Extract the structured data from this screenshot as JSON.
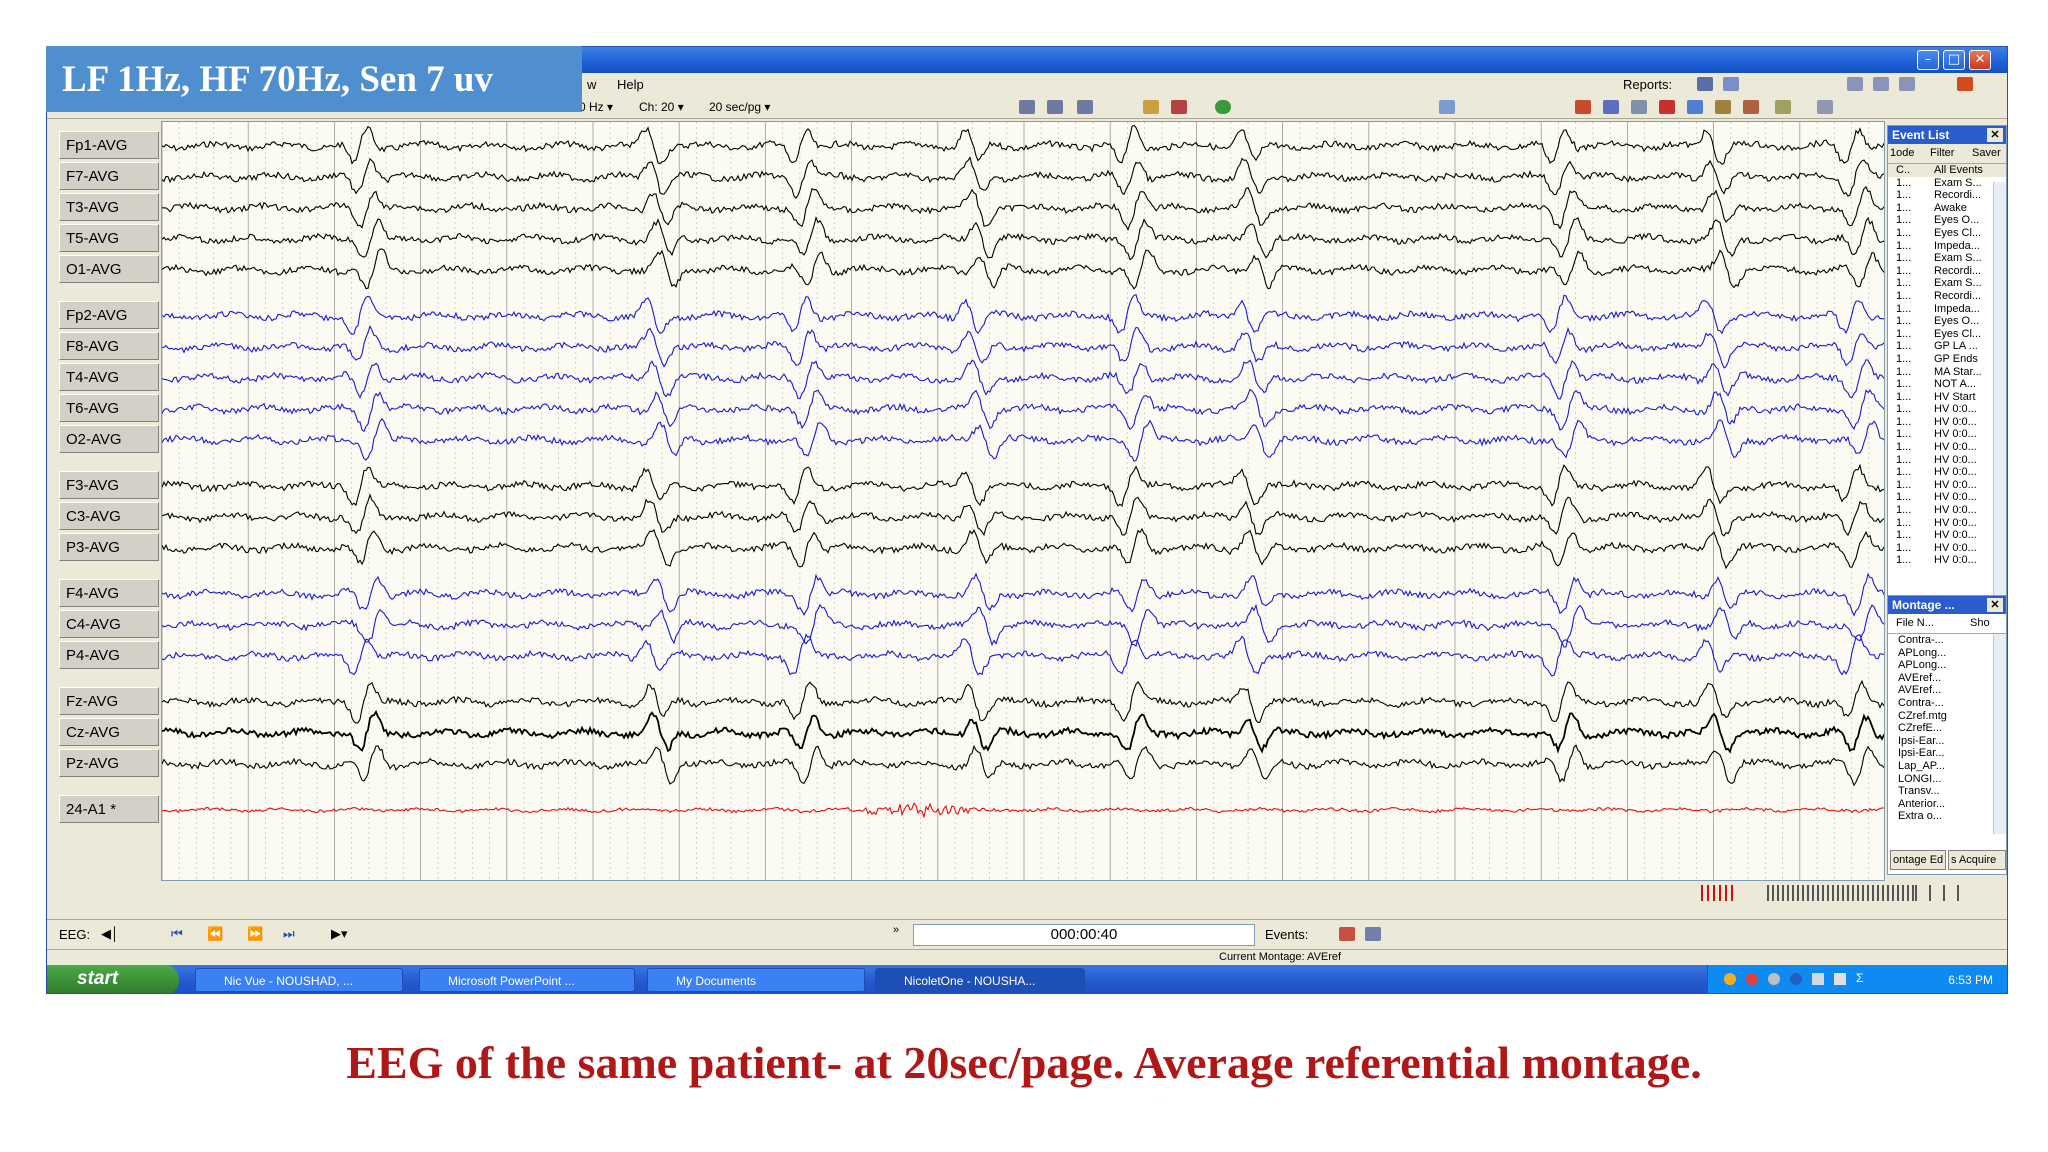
{
  "overlay": {
    "settings": "LF 1Hz, HF 70Hz, Sen 7 uv"
  },
  "window": {
    "menu": [
      "w",
      "Help"
    ],
    "reports_label": "Reports:",
    "toolbar": {
      "filter_fragment": "0 Hz",
      "channels": "Ch: 20",
      "speed": "20 sec/pg"
    }
  },
  "channels": [
    {
      "label": "Fp1-AVG",
      "color": "#000000"
    },
    {
      "label": "F7-AVG",
      "color": "#000000"
    },
    {
      "label": "T3-AVG",
      "color": "#000000"
    },
    {
      "label": "T5-AVG",
      "color": "#000000"
    },
    {
      "label": "O1-AVG",
      "color": "#000000"
    },
    {
      "label": "Fp2-AVG",
      "color": "#1a1ad0"
    },
    {
      "label": "F8-AVG",
      "color": "#1a1ad0"
    },
    {
      "label": "T4-AVG",
      "color": "#1a1ad0"
    },
    {
      "label": "T6-AVG",
      "color": "#1a1ad0"
    },
    {
      "label": "O2-AVG",
      "color": "#1a1ad0"
    },
    {
      "label": "F3-AVG",
      "color": "#000000"
    },
    {
      "label": "C3-AVG",
      "color": "#000000"
    },
    {
      "label": "P3-AVG",
      "color": "#000000"
    },
    {
      "label": "F4-AVG",
      "color": "#1a1ad0"
    },
    {
      "label": "C4-AVG",
      "color": "#1a1ad0"
    },
    {
      "label": "P4-AVG",
      "color": "#1a1ad0"
    },
    {
      "label": "Fz-AVG",
      "color": "#000000"
    },
    {
      "label": "Cz-AVG",
      "color": "#000000"
    },
    {
      "label": "Pz-AVG",
      "color": "#000000"
    },
    {
      "label": "24-A1 *",
      "color": "#e01010"
    }
  ],
  "event_list": {
    "title": "Event List",
    "tabs": [
      "1ode",
      "Filter",
      "Saver"
    ],
    "columns": [
      "C..",
      "All Events"
    ],
    "items": [
      {
        "c": "1...",
        "name": "Exam S..."
      },
      {
        "c": "1...",
        "name": "Recordi..."
      },
      {
        "c": "1...",
        "name": "Awake"
      },
      {
        "c": "1...",
        "name": "Eyes O..."
      },
      {
        "c": "1...",
        "name": "Eyes Cl..."
      },
      {
        "c": "1...",
        "name": "Impeda..."
      },
      {
        "c": "1...",
        "name": "Exam S..."
      },
      {
        "c": "1...",
        "name": "Recordi..."
      },
      {
        "c": "1...",
        "name": "Exam S..."
      },
      {
        "c": "1...",
        "name": "Recordi..."
      },
      {
        "c": "1...",
        "name": "Impeda..."
      },
      {
        "c": "1...",
        "name": "Eyes O..."
      },
      {
        "c": "1...",
        "name": "Eyes Cl..."
      },
      {
        "c": "1...",
        "name": "GP LA ..."
      },
      {
        "c": "1...",
        "name": "GP Ends"
      },
      {
        "c": "1...",
        "name": "MA Star..."
      },
      {
        "c": "1...",
        "name": "NOT A..."
      },
      {
        "c": "1...",
        "name": "HV Start"
      },
      {
        "c": "1...",
        "name": "HV 0:0..."
      },
      {
        "c": "1...",
        "name": "HV 0:0..."
      },
      {
        "c": "1...",
        "name": "HV 0:0..."
      },
      {
        "c": "1...",
        "name": "HV 0:0..."
      },
      {
        "c": "1...",
        "name": "HV 0:0..."
      },
      {
        "c": "1...",
        "name": "HV 0:0..."
      },
      {
        "c": "1...",
        "name": "HV 0:0..."
      },
      {
        "c": "1...",
        "name": "HV 0:0..."
      },
      {
        "c": "1...",
        "name": "HV 0:0..."
      },
      {
        "c": "1...",
        "name": "HV 0:0..."
      },
      {
        "c": "1...",
        "name": "HV 0:0..."
      },
      {
        "c": "1...",
        "name": "HV 0:0..."
      },
      {
        "c": "1...",
        "name": "HV 0:0..."
      }
    ]
  },
  "montage": {
    "title": "Montage ...",
    "columns": [
      "File N...",
      "Sho"
    ],
    "items": [
      "Contra-...",
      "APLong...",
      "APLong...",
      "AVEref...",
      "AVEref...",
      "Contra-...",
      "CZref.mtg",
      "CZrefE...",
      "Ipsi-Ear...",
      "Ipsi-Ear...",
      "Lap_AP...",
      "LONGI...",
      "Transv...",
      "Anterior...",
      "Extra o..."
    ],
    "buttons": [
      "ontage Ed",
      "s Acquire"
    ]
  },
  "status": {
    "eeg_label": "EEG:",
    "time": "000:00:40",
    "events_label": "Events:",
    "current_montage": "Current Montage: AVEref"
  },
  "taskbar": {
    "start": "start",
    "buttons": [
      "Nic Vue - NOUSHAD, ...",
      "Microsoft PowerPoint ...",
      "My Documents",
      "NicoletOne - NOUSHA..."
    ],
    "clock": "6:53 PM"
  },
  "caption": "EEG of  the same patient- at 20sec/page. Average referential montage.",
  "colors": {
    "plot_background": "#fbfbf3",
    "caption": "#b01818",
    "overlay_box": "#4f8fcf"
  }
}
